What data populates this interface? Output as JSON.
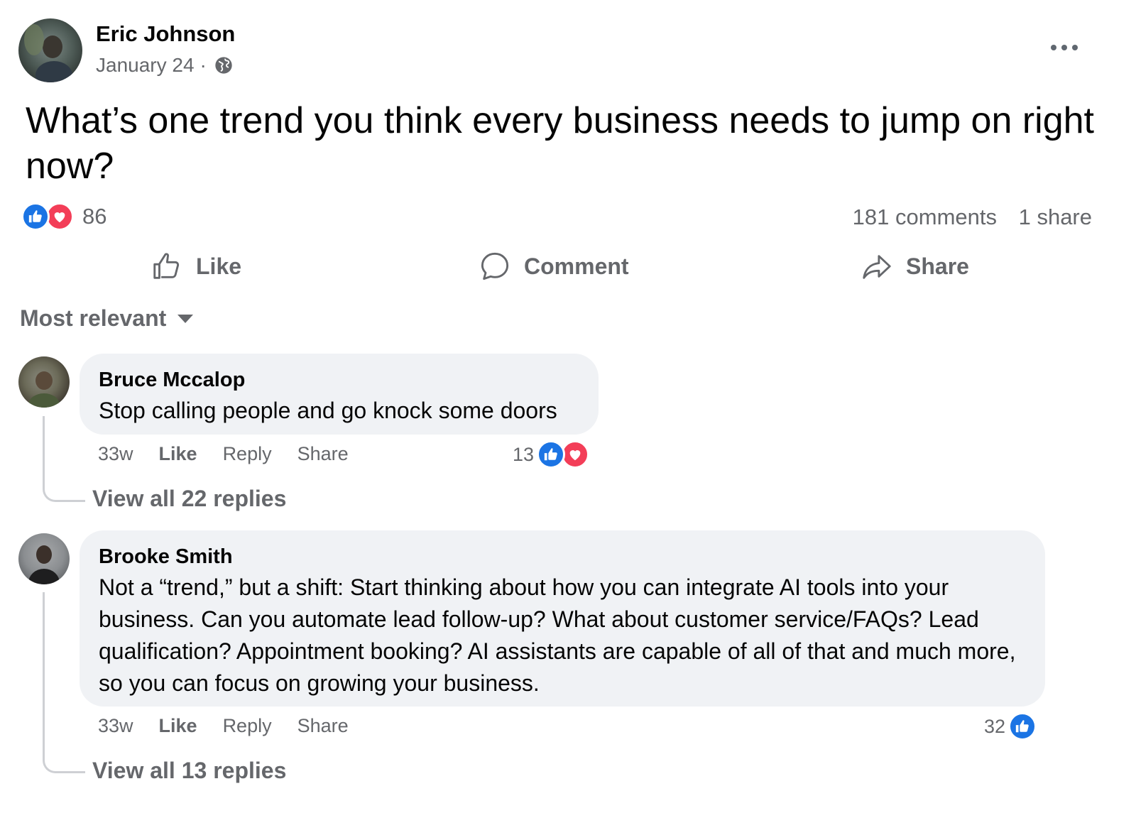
{
  "post": {
    "author": "Eric Johnson",
    "date": "January 24",
    "separator": "·",
    "privacy_icon": "globe-icon",
    "text": "What’s one trend you think every business needs to jump on right now?",
    "reaction_icons": [
      "like-reaction-icon",
      "love-reaction-icon"
    ],
    "reaction_count": "86",
    "comments_count": "181 comments",
    "shares_count": "1 share"
  },
  "actions": {
    "like": "Like",
    "comment": "Comment",
    "share": "Share"
  },
  "sort": {
    "label": "Most relevant"
  },
  "comments": [
    {
      "author": "Bruce Mccalop",
      "text": "Stop calling people and go knock some doors",
      "time": "33w",
      "like": "Like",
      "reply": "Reply",
      "share": "Share",
      "reaction_count": "13",
      "reaction_icons": [
        "like-reaction-icon",
        "love-reaction-icon"
      ],
      "view_replies": "View all 22 replies"
    },
    {
      "author": "Brooke Smith",
      "text": "Not a “trend,” but a shift: Start thinking about how you can integrate AI tools into your business. Can you automate lead follow-up? What about customer service/FAQs? Lead qualification? Appointment booking? AI assistants are capable of all of that and much more, so you can focus on growing your business.",
      "time": "33w",
      "like": "Like",
      "reply": "Reply",
      "share": "Share",
      "reaction_count": "32",
      "reaction_icons": [
        "like-reaction-icon"
      ],
      "view_replies": "View all 13 replies"
    }
  ],
  "colors": {
    "like_blue": "#1b74e4",
    "love_red": "#f33e58",
    "secondary_text": "#65676b",
    "bubble_bg": "#f0f2f5"
  }
}
